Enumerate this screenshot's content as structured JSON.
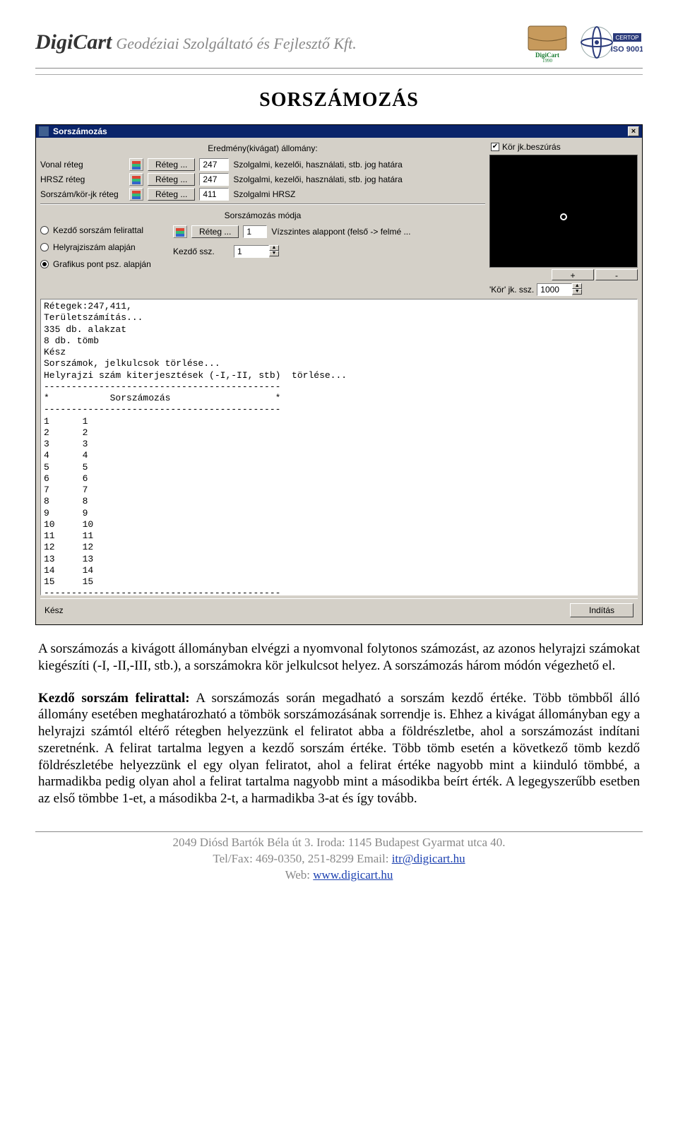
{
  "header": {
    "company_name": "DigiCart",
    "company_sub": "Geodéziai Szolgáltató és Fejlesztő Kft.",
    "logo1_alt": "DigiCart 1990",
    "logo2_alt": "ISO 9001"
  },
  "doc": {
    "title": "SORSZÁMOZÁS"
  },
  "win": {
    "title": "Sorszámozás",
    "close_x": "×",
    "result_label": "Eredmény(kivágat) állomány:",
    "rows": [
      {
        "label": "Vonal réteg",
        "btn": "Réteg ...",
        "num": "247",
        "desc": "Szolgalmi, kezelői, használati, stb. jog határa"
      },
      {
        "label": "HRSZ réteg",
        "btn": "Réteg ...",
        "num": "247",
        "desc": "Szolgalmi, kezelői, használati, stb. jog határa"
      },
      {
        "label": "Sorszám/kör-jk réteg",
        "btn": "Réteg ...",
        "num": "411",
        "desc": "Szolgalmi HRSZ"
      }
    ],
    "kor_check": "Kör jk.beszúrás",
    "plus": "+",
    "minus": "-",
    "kor_ssz_label": "'Kör' jk. ssz.",
    "kor_ssz_value": "1000",
    "mode_title": "Sorszámozás módja",
    "mode_radios": [
      "Kezdő sorszám felirattal",
      "Helyrajziszám alapján",
      "Grafikus pont psz. alapján"
    ],
    "mode_reteg_btn": "Réteg ...",
    "mode_reteg_num": "1",
    "mode_reteg_desc": "Vízszintes alappont (felső -> felmé ...",
    "mode_kezdo_label": "Kezdő ssz.",
    "mode_kezdo_value": "1",
    "log_text": "Rétegek:247,411,\nTerületszámítás...\n335 db. alakzat\n8 db. tömb\nKész\nSorszámok, jelkulcsok törlése...\nHelyrajzi szám kiterjesztések (-I,-II, stb)  törlése...\n-------------------------------------------\n*           Sorszámozás                   *\n-------------------------------------------\n1      1\n2      2\n3      3\n4      4\n5      5\n6      6\n7      7\n8      8\n9      9\n10     10\n11     11\n12     12\n13     13\n14     14\n15     15\n-------------------------------------------",
    "status": "Kész",
    "start": "Indítás"
  },
  "body": {
    "p1": "A sorszámozás a kivágott állományban elvégzi a nyomvonal folytonos számozást, az azonos helyrajzi számokat kiegészíti (-I, -II,-III, stb.), a sorszámokra kör jelkulcsot helyez. A sorszámozás három módón végezhető el.",
    "p2_lead": "Kezdő sorszám felirattal:",
    "p2": " A sorszámozás során megadható a sorszám kezdő értéke. Több tömbből álló állomány esetében meghatározható a tömbök sorszámozásának sorrendje is. Ehhez a kivágat állományban egy a helyrajzi számtól eltérő rétegben helyezzünk el feliratot abba a földrészletbe, ahol a sorszámozást indítani szeretnénk. A felirat tartalma legyen a kezdő sorszám értéke. Több tömb esetén a következő tömb kezdő földrészletébe helyezzünk el egy olyan feliratot, ahol a felirat értéke nagyobb mint a kiinduló tömbbé, a harmadikba pedig olyan ahol a felirat tartalma nagyobb mint a másodikba beírt érték. A legegyszerűbb esetben az első tömbbe 1-et, a másodikba 2-t, a harmadikba 3-at és így tovább."
  },
  "footer": {
    "line1": "2049 Diósd Bartók Béla út 3. Iroda: 1145 Budapest Gyarmat utca 40.",
    "line2a": "Tel/Fax: 469-0350, 251-8299 Email: ",
    "email": "itr@digicart.hu",
    "line3a": "Web: ",
    "web": "www.digicart.hu"
  }
}
